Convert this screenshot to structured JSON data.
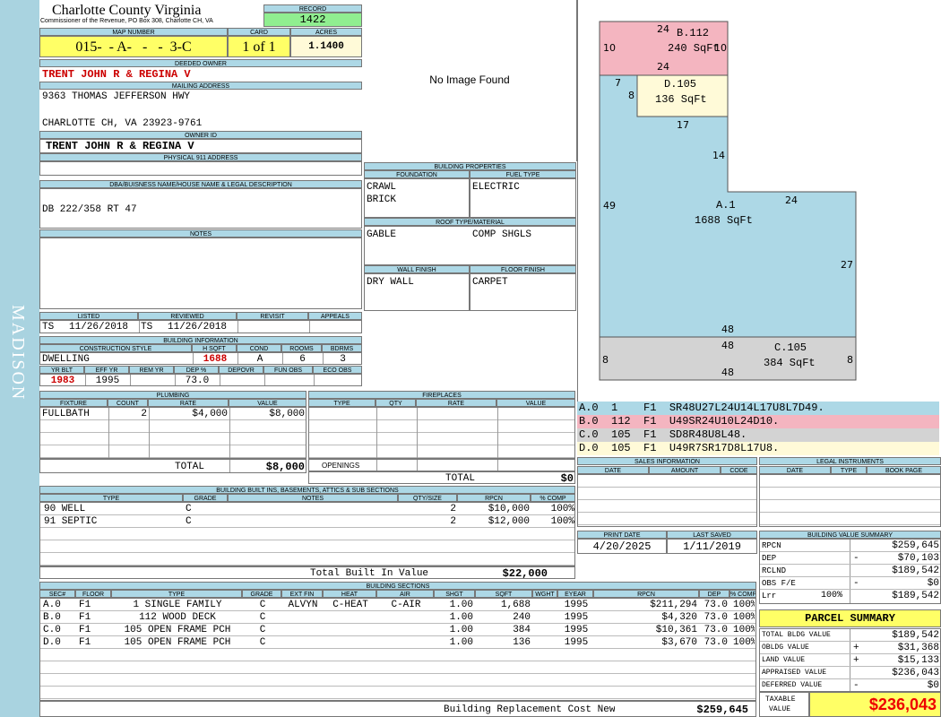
{
  "sidebar_text": "MADISON",
  "title": "Charlotte County Virginia",
  "subtitle": "Commissioner of the Revenue, PO Box 308, Charlotte CH, VA",
  "record": {
    "label": "RECORD",
    "value": "1422"
  },
  "map": {
    "label": "MAP NUMBER",
    "value": "015-  - A-   -   -  3-C"
  },
  "card": {
    "label": "CARD",
    "value": "1 of 1"
  },
  "acres": {
    "label": "ACRES",
    "value": "1.1400"
  },
  "deeded_owner": {
    "label": "DEEDED OWNER",
    "value": "TRENT JOHN R & REGINA V"
  },
  "mailing": {
    "label": "MAILING ADDRESS",
    "line1": "9363 THOMAS JEFFERSON HWY",
    "line2": "CHARLOTTE CH, VA 23923-9761"
  },
  "owner_id": {
    "label": "OWNER ID",
    "value": "TRENT JOHN R & REGINA V"
  },
  "physical_address": {
    "label": "PHYSICAL 911 ADDRESS",
    "value": ""
  },
  "dba": {
    "label": "DBA/BUISNESS NAME/HOUSE NAME & LEGAL DESCRIPTION",
    "value": "DB 222/358 RT 47"
  },
  "notes": {
    "label": "NOTES",
    "value": ""
  },
  "no_image": "No Image Found",
  "building_properties": {
    "label": "BUILDING PROPERTIES",
    "foundation_label": "FOUNDATION",
    "foundation": [
      "CRAWL",
      "BRICK"
    ],
    "fuel_label": "FUEL TYPE",
    "fuel": "ELECTRIC",
    "roof_label": "ROOF TYPE/MATERIAL",
    "roof_type": "GABLE",
    "roof_material": "COMP SHGLS",
    "wall_label": "WALL FINISH",
    "wall": "DRY WALL",
    "floor_label": "FLOOR FINISH",
    "floor": "CARPET"
  },
  "listing": {
    "listed_label": "LISTED",
    "reviewed_label": "REVIEWED",
    "revisit_label": "REVISIT",
    "appeals_label": "APPEALS",
    "listed_by": "TS",
    "listed_date": "11/26/2018",
    "reviewed_by": "TS",
    "reviewed_date": "11/26/2018"
  },
  "building_info": {
    "label": "BUILDING INFORMATION",
    "h_style": "CONSTRUCTION STYLE",
    "h_sqft": "H SQFT",
    "h_cond": "COND",
    "h_rooms": "ROOMS",
    "h_bdrms": "BDRMS",
    "style": "DWELLING",
    "sqft": "1688",
    "cond": "A",
    "rooms": "6",
    "bdrms": "3",
    "h_yrblt": "YR BLT",
    "h_effyr": "EFF YR",
    "h_remyr": "REM YR",
    "h_dep": "DEP %",
    "h_depovr": "DEPOVR",
    "h_funobs": "FUN OBS",
    "h_ecoobs": "ECO OBS",
    "yrblt": "1983",
    "effyr": "1995",
    "remyr": "",
    "dep": "73.0",
    "depovr": "",
    "funobs": "",
    "ecoobs": ""
  },
  "plumbing": {
    "label": "PLUMBING",
    "headers": [
      "FIXTURE",
      "COUNT",
      "RATE",
      "VALUE"
    ],
    "rows": [
      {
        "fixture": "FULLBATH",
        "count": "2",
        "rate": "$4,000",
        "value": "$8,000"
      }
    ],
    "total_label": "TOTAL",
    "total": "$8,000"
  },
  "fireplaces": {
    "label": "FIREPLACES",
    "headers": [
      "TYPE",
      "QTY",
      "RATE",
      "VALUE"
    ],
    "openings_label": "OPENINGS",
    "total_label": "TOTAL",
    "total": "$0"
  },
  "sketch": {
    "labels": {
      "b_top": "24",
      "b_name": "B.112",
      "b_area": "240 SqFt",
      "b_left": "10",
      "b_right": "10",
      "b_bottom": "24",
      "d_left": "7",
      "d_inner": "8",
      "d_name": "D.105",
      "d_area": "136 SqFt",
      "d_bottom": "17",
      "a_notch": "14",
      "a_left": "49",
      "a_name": "A.1",
      "a_area": "1688 SqFt",
      "a_step": "24",
      "a_right": "27",
      "a_bottom": "48",
      "c_top": "48",
      "c_name": "C.105",
      "c_area": "384 SqFt",
      "c_left": "8",
      "c_right": "8",
      "c_bottom": "48"
    },
    "colors": {
      "a": "#add8e6",
      "b": "#f4b5c0",
      "c": "#d3d3d3",
      "d": "#fffad8"
    }
  },
  "sketch_codes": [
    {
      "text": "A.0  1    F1  SR48U27L24U14L17U8L7D49.",
      "color": "#add8e6"
    },
    {
      "text": "B.0  112  F1  U49SR24U10L24D10.",
      "color": "#f4b5c0"
    },
    {
      "text": "C.0  105  F1  SD8R48U8L48.",
      "color": "#d3d3d3"
    },
    {
      "text": "D.0  105  F1  U49R7SR17D8L17U8.",
      "color": "#fffad8"
    }
  ],
  "sales": {
    "label": "SALES INFORMATION",
    "headers": [
      "DATE",
      "AMOUNT",
      "CODE"
    ]
  },
  "legal": {
    "label": "LEGAL INSTRUMENTS",
    "headers": [
      "DATE",
      "TYPE",
      "BOOK PAGE"
    ]
  },
  "print": {
    "print_label": "PRINT DATE",
    "print_date": "4/20/2025",
    "saved_label": "LAST SAVED",
    "saved_date": "1/11/2019"
  },
  "built_ins": {
    "label": "BUILDING BUILT INS, BASEMENTS, ATTICS & SUB SECTIONS",
    "headers": [
      "TYPE",
      "GRADE",
      "NOTES",
      "QTY/SIZE",
      "RPCN",
      "% COMP"
    ],
    "rows": [
      {
        "type": "90 WELL",
        "grade": "C",
        "notes": "",
        "qty": "2",
        "rpcn": "$10,000",
        "comp": "100%"
      },
      {
        "type": "91 SEPTIC",
        "grade": "C",
        "notes": "",
        "qty": "2",
        "rpcn": "$12,000",
        "comp": "100%"
      }
    ],
    "total_label": "Total Built In Value",
    "total": "$22,000"
  },
  "value_summary": {
    "label": "BUILDING VALUE SUMMARY",
    "rows": [
      {
        "label": "RPCN",
        "pct": "",
        "sign": "",
        "value": "$259,645"
      },
      {
        "label": "DEP",
        "pct": "",
        "sign": "-",
        "value": "$70,103"
      },
      {
        "label": "RCLND",
        "pct": "",
        "sign": "",
        "value": "$189,542"
      },
      {
        "label": "OBS F/E",
        "pct": "",
        "sign": "-",
        "value": "$0"
      },
      {
        "label": "Lrr",
        "pct": "100%",
        "sign": "",
        "value": "$189,542"
      }
    ]
  },
  "parcel_summary": {
    "label": "PARCEL SUMMARY",
    "rows": [
      {
        "label": "TOTAL BLDG VALUE",
        "sign": "",
        "value": "$189,542"
      },
      {
        "label": "OBLDG VALUE",
        "sign": "+",
        "value": "$31,368"
      },
      {
        "label": "LAND VALUE",
        "sign": "+",
        "value": "$15,133"
      },
      {
        "label": "APPRAISED VALUE",
        "sign": "",
        "value": "$236,043"
      },
      {
        "label": "DEFERRED VALUE",
        "sign": "-",
        "value": "$0"
      }
    ],
    "taxable_label1": "TAXABLE",
    "taxable_label2": "VALUE",
    "taxable": "$236,043"
  },
  "sections": {
    "label": "BUILDING SECTIONS",
    "headers": [
      "SEC#",
      "FLOOR",
      "TYPE",
      "GRADE",
      "EXT FIN",
      "HEAT",
      "AIR",
      "SHGT",
      "SQFT",
      "WGHT",
      "EYEAR",
      "RPCN",
      "DEP",
      "% COMP"
    ],
    "rows": [
      {
        "sec": "A.0",
        "floor": "F1",
        "type": "1 SINGLE FAMILY",
        "grade": "C",
        "ext": "ALVYN",
        "heat": "C-HEAT",
        "air": "C-AIR",
        "shgt": "1.00",
        "sqft": "1,688",
        "wght": "",
        "eyear": "1995",
        "rpcn": "$211,294",
        "dep": "73.0",
        "comp": "100%"
      },
      {
        "sec": "B.0",
        "floor": "F1",
        "type": "112 WOOD DECK",
        "grade": "C",
        "ext": "",
        "heat": "",
        "air": "",
        "shgt": "1.00",
        "sqft": "240",
        "wght": "",
        "eyear": "1995",
        "rpcn": "$4,320",
        "dep": "73.0",
        "comp": "100%"
      },
      {
        "sec": "C.0",
        "floor": "F1",
        "type": "105 OPEN FRAME PCH",
        "grade": "C",
        "ext": "",
        "heat": "",
        "air": "",
        "shgt": "1.00",
        "sqft": "384",
        "wght": "",
        "eyear": "1995",
        "rpcn": "$10,361",
        "dep": "73.0",
        "comp": "100%"
      },
      {
        "sec": "D.0",
        "floor": "F1",
        "type": "105 OPEN FRAME PCH",
        "grade": "C",
        "ext": "",
        "heat": "",
        "air": "",
        "shgt": "1.00",
        "sqft": "136",
        "wght": "",
        "eyear": "1995",
        "rpcn": "$3,670",
        "dep": "73.0",
        "comp": "100%"
      }
    ],
    "total_label": "Building Replacement Cost New",
    "total": "$259,645"
  }
}
